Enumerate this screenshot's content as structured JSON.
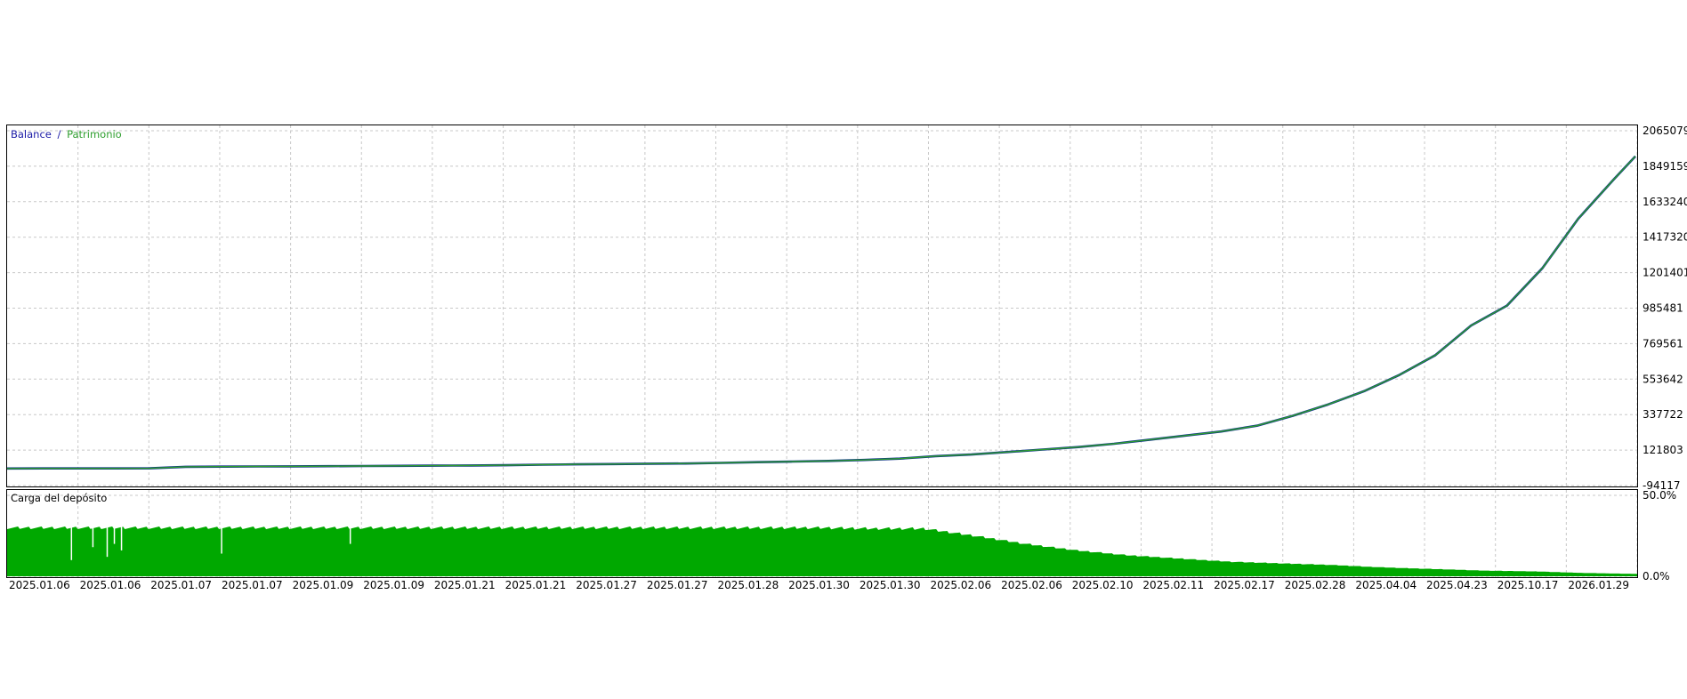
{
  "colors": {
    "balance": "#1a1aa6",
    "equity": "#2e9e2e",
    "balance_line": "#0b2b8c",
    "load_fill": "#00a800",
    "grid": "#c8c8c8",
    "frame": "#000000",
    "text": "#000000"
  },
  "chart_data": [
    {
      "type": "line",
      "title": "",
      "legend": {
        "balance": "Balance",
        "separator": "/",
        "equity": "Patrimonio",
        "placement": "top-left"
      },
      "y_ticks": [
        "2065079",
        "1849159",
        "1633240",
        "1417320",
        "1201401",
        "985481",
        "769561",
        "553642",
        "337722",
        "121803",
        "-94117"
      ],
      "ylim": [
        -94117,
        2065079
      ],
      "grid": true,
      "x": [
        0,
        5,
        10,
        15,
        20,
        25,
        30,
        35,
        40,
        45,
        50,
        55,
        60,
        65,
        70,
        75,
        80,
        85,
        90,
        95,
        100,
        105,
        110,
        115,
        120,
        125,
        130,
        135,
        140,
        145,
        150,
        155,
        160,
        165,
        170,
        175,
        180,
        185,
        190,
        195,
        200,
        205,
        210,
        215,
        220,
        225,
        228
      ],
      "series": [
        {
          "name": "Balance",
          "values": [
            10000,
            10100,
            10200,
            10300,
            11000,
            20000,
            21000,
            22000,
            23000,
            24000,
            25000,
            26000,
            27000,
            28000,
            30000,
            33000,
            35000,
            37000,
            39000,
            40000,
            44000,
            48000,
            52000,
            56000,
            62000,
            70000,
            85000,
            95000,
            110000,
            125000,
            140000,
            160000,
            185000,
            210000,
            235000,
            270000,
            330000,
            400000,
            480000,
            580000,
            700000,
            880000,
            1000000,
            1230000,
            1530000,
            1770000,
            1910000
          ]
        },
        {
          "name": "Patrimonio",
          "values": [
            10000,
            10100,
            10200,
            10300,
            11000,
            20000,
            21000,
            22000,
            23000,
            24000,
            25000,
            26000,
            27000,
            28000,
            30000,
            33000,
            35000,
            37000,
            39000,
            40000,
            44000,
            48000,
            52000,
            56000,
            62000,
            70000,
            85000,
            95000,
            110000,
            125000,
            140000,
            160000,
            185000,
            210000,
            235000,
            270000,
            330000,
            400000,
            480000,
            580000,
            700000,
            880000,
            1000000,
            1230000,
            1530000,
            1770000,
            1910000
          ]
        }
      ]
    },
    {
      "type": "area",
      "title": "Carga del depósito",
      "y_ticks": [
        "50.0%",
        "0.0%"
      ],
      "ylim": [
        0,
        50
      ],
      "grid": true,
      "x_ticks": [
        "2025.01.06",
        "2025.01.06",
        "2025.01.07",
        "2025.01.07",
        "2025.01.09",
        "2025.01.09",
        "2025.01.21",
        "2025.01.21",
        "2025.01.27",
        "2025.01.27",
        "2025.01.28",
        "2025.01.30",
        "2025.01.30",
        "2025.02.06",
        "2025.02.06",
        "2025.02.10",
        "2025.02.11",
        "2025.02.17",
        "2025.02.28",
        "2025.04.04",
        "2025.04.23",
        "2025.10.17",
        "2026.01.29"
      ],
      "x": [
        0,
        10,
        20,
        30,
        40,
        50,
        60,
        70,
        80,
        90,
        100,
        110,
        120,
        130,
        140,
        150,
        160,
        170,
        180,
        190,
        200,
        210,
        220,
        228
      ],
      "values": [
        30,
        30,
        30,
        30,
        30,
        30,
        30,
        30,
        30,
        30,
        30,
        30,
        30,
        30,
        30,
        30,
        30,
        29.5,
        29.5,
        25,
        20,
        16,
        13,
        11,
        9,
        8,
        7,
        5.5,
        4.5,
        3.5,
        3,
        2,
        1.5
      ],
      "dips": [
        {
          "x": 9,
          "value": 10
        },
        {
          "x": 12,
          "value": 18
        },
        {
          "x": 14,
          "value": 12
        },
        {
          "x": 15,
          "value": 20
        },
        {
          "x": 16,
          "value": 16
        },
        {
          "x": 30,
          "value": 14
        },
        {
          "x": 48,
          "value": 20
        }
      ]
    }
  ]
}
